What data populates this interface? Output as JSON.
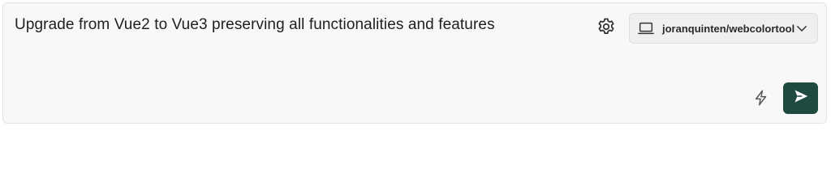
{
  "composer": {
    "prompt_text": "Upgrade from Vue2 to Vue3 preserving all functionalities and features",
    "repository": "joranquinten/webcolortool"
  },
  "icons": {
    "settings": "gear-icon",
    "repo": "laptop-icon",
    "dropdown": "chevron-down-icon",
    "quick": "lightning-bolt-icon",
    "send": "send-arrow-icon"
  },
  "colors": {
    "send_button_bg": "#1f4a40",
    "panel_bg": "#f8f8f8"
  }
}
